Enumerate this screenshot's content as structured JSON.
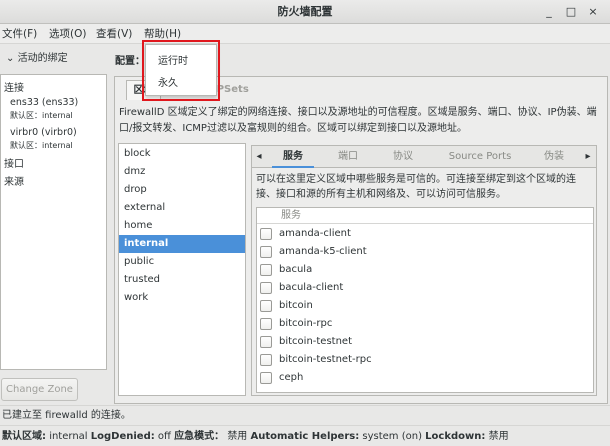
{
  "window": {
    "title": "防火墙配置",
    "min": "_",
    "max": "□",
    "close": "×"
  },
  "menubar": {
    "file": "文件(F)",
    "options": "选项(O)",
    "view": "查看(V)",
    "help": "帮助(H)"
  },
  "left_panel": {
    "header": "活动的绑定",
    "connections_head": "连接",
    "connections": [
      {
        "name": "ens33 (ens33)",
        "zone": "默认区：internal"
      },
      {
        "name": "virbr0 (virbr0)",
        "zone": "默认区：internal"
      }
    ],
    "interfaces_head": "接口",
    "sources_head": "来源",
    "change_zone": "Change Zone"
  },
  "config": {
    "label": "配置：",
    "popup_items": [
      "运行时",
      "永久"
    ]
  },
  "tabs": {
    "zones": "区域",
    "ipsets": "IPSets"
  },
  "description": "FirewallD 区域定义了绑定的网络连接、接口以及源地址的可信程度。区域是服务、端口、协议、IP伪装、端口/报文转发、ICMP过滤以及富规则的组合。区域可以绑定到接口以及源地址。",
  "zones": [
    "block",
    "dmz",
    "drop",
    "external",
    "home",
    "internal",
    "public",
    "trusted",
    "work"
  ],
  "selected_zone": "internal",
  "inner_tabs": [
    "服务",
    "端口",
    "协议",
    "Source Ports",
    "伪装"
  ],
  "inner_description": "可以在这里定义区域中哪些服务是可信的。可连接至绑定到这个区域的连接、接口和源的所有主机和网络及、可以访问可信服务。",
  "services_header": "服务",
  "services": [
    "amanda-client",
    "amanda-k5-client",
    "bacula",
    "bacula-client",
    "bitcoin",
    "bitcoin-rpc",
    "bitcoin-testnet",
    "bitcoin-testnet-rpc",
    "ceph"
  ],
  "status": "已建立至 firewalld 的连接。",
  "statusbar": {
    "default_zone_label": "默认区域:",
    "default_zone": "internal",
    "logdenied_label": "LogDenied:",
    "logdenied": "off",
    "panic_label": "应急模式：",
    "panic": "禁用",
    "helpers_label": "Automatic Helpers:",
    "helpers": "system (on)",
    "lockdown_label": "Lockdown:",
    "lockdown": "禁用"
  },
  "colors": {
    "selection": "#4a90d9",
    "highlight_outline": "#e0171d"
  }
}
